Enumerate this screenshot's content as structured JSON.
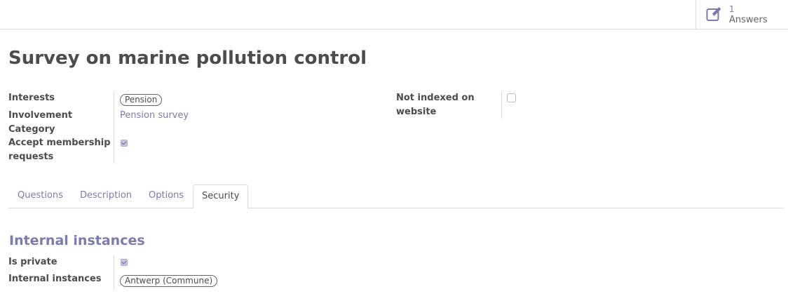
{
  "smart_button": {
    "value": "1",
    "label": "Answers",
    "icon": "pencil-square-icon"
  },
  "title": "Survey on marine pollution control",
  "fields": {
    "interests_label": "Interests",
    "interests_tag": "Pension",
    "involvement_label_1": "Involvement",
    "involvement_label_2": "Category",
    "involvement_value": "Pension survey",
    "accept_label_1": "Accept membership",
    "accept_label_2": "requests",
    "accept_checked": true,
    "not_indexed_label_1": "Not indexed on",
    "not_indexed_label_2": "website",
    "not_indexed_checked": false
  },
  "tabs": [
    {
      "label": "Questions",
      "active": false
    },
    {
      "label": "Description",
      "active": false
    },
    {
      "label": "Options",
      "active": false
    },
    {
      "label": "Security",
      "active": true
    }
  ],
  "security": {
    "section_title": "Internal instances",
    "is_private_label": "Is private",
    "is_private_checked": true,
    "internal_instances_label": "Internal instances",
    "internal_instances_tag": "Antwerp (Commune)"
  },
  "colors": {
    "accent": "#7c7bad",
    "text": "#4c4c4c",
    "border": "#dcdcdc"
  }
}
